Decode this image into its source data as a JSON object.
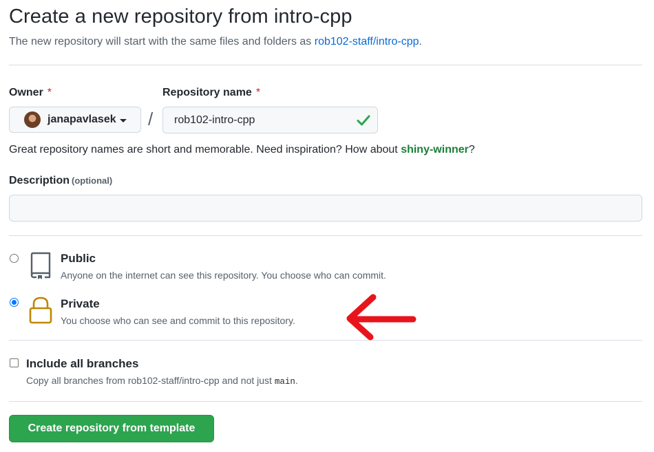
{
  "header": {
    "title": "Create a new repository from intro-cpp",
    "subtitle_prefix": "The new repository will start with the same files and folders as ",
    "template_link": "rob102-staff/intro-cpp",
    "subtitle_suffix": "."
  },
  "owner": {
    "label": "Owner",
    "required_mark": "*",
    "selected": "janapavlasek"
  },
  "separator": "/",
  "repo_name": {
    "label": "Repository name",
    "required_mark": "*",
    "value": "rob102-intro-cpp"
  },
  "hint": {
    "prefix": "Great repository names are short and memorable. Need inspiration? How about ",
    "suggestion": "shiny-winner",
    "suffix": "?"
  },
  "description": {
    "label": "Description",
    "optional": "(optional)",
    "value": "",
    "placeholder": ""
  },
  "visibility": {
    "public": {
      "title": "Public",
      "desc": "Anyone on the internet can see this repository. You choose who can commit."
    },
    "private": {
      "title": "Private",
      "desc": "You choose who can see and commit to this repository."
    },
    "selected": "private"
  },
  "branches": {
    "title": "Include all branches",
    "desc_prefix": "Copy all branches from rob102-staff/intro-cpp and not just ",
    "desc_code": "main",
    "desc_suffix": ".",
    "checked": false
  },
  "submit_label": "Create repository from template",
  "colors": {
    "accent_green": "#2da44e",
    "link_blue": "#0969da",
    "required_red": "#cf222e",
    "annotation_arrow": "#e8141c",
    "lock_gold": "#bf8700"
  }
}
